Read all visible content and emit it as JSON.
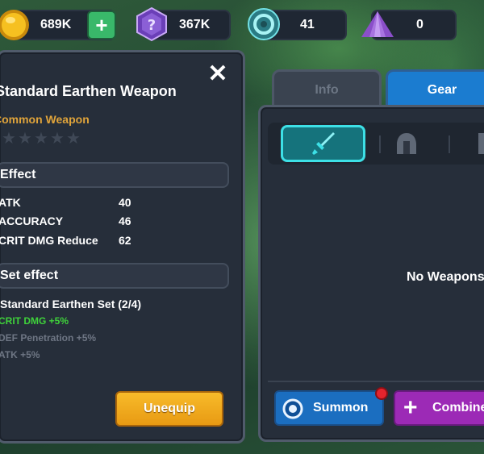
{
  "resources": {
    "gold": "689K",
    "gems": "367K",
    "tokens": "41",
    "crystals": "0"
  },
  "item": {
    "title": "Standard Earthen Weapon",
    "rarity": "Common Weapon",
    "stars_filled": 0,
    "stars_total": 5,
    "effect_header": "Effect",
    "stats": [
      {
        "name": "ATK",
        "value": "40"
      },
      {
        "name": "ACCURACY",
        "value": "46"
      },
      {
        "name": "CRIT DMG Reduce",
        "value": "62"
      }
    ],
    "set_header": "Set effect",
    "set_name": "Standard Earthen Set (2/4)",
    "set_bonuses": [
      {
        "text": "CRIT DMG +5%",
        "active": true
      },
      {
        "text": "DEF Penetration +5%",
        "active": false
      },
      {
        "text": "ATK +5%",
        "active": false
      }
    ],
    "unequip_label": "Unequip"
  },
  "tabs": {
    "info": "Info",
    "gear": "Gear"
  },
  "inventory": {
    "empty_message": "No Weapons",
    "summon_label": "Summon",
    "combine_label": "Combine"
  },
  "colors": {
    "rarity": "#e0a43a",
    "active_bonus": "#3fd23a",
    "inactive_bonus": "#6e7684",
    "unequip": "#f5ad1f",
    "summon": "#1b6ec0",
    "combine": "#9c2ab6",
    "filter_active": "#3de0e6"
  }
}
